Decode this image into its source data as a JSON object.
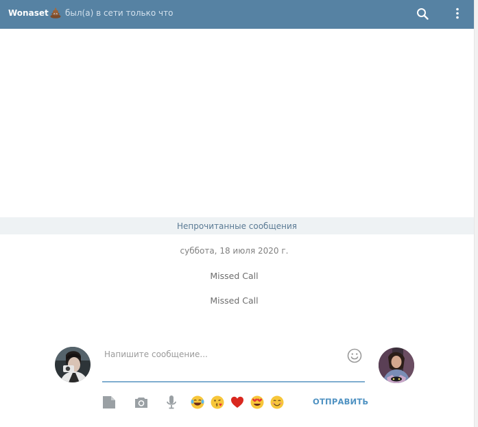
{
  "header": {
    "contact_name": "Wonaset",
    "emoji_icon": "pile-of-poo-icon",
    "status": "был(а) в сети только что",
    "background_color": "#5682a3"
  },
  "messages": {
    "unread_label": "Непрочитанные сообщения",
    "date": "суббота, 18 июля 2020 г.",
    "items": [
      "Missed Call",
      "Missed Call"
    ]
  },
  "composer": {
    "placeholder": "Напишите сообщение...",
    "value": "",
    "send_label": "ОТПРАВИТЬ",
    "tools": [
      "document-icon",
      "camera-icon",
      "microphone-icon"
    ],
    "quick_emojis": [
      "face-with-tears-of-joy-icon",
      "face-blowing-kiss-icon",
      "red-heart-icon",
      "heart-eyes-icon",
      "smiling-face-icon"
    ]
  },
  "colors": {
    "accent": "#4f92c2",
    "underline": "#7eaccf",
    "unread_band": "#eef2f4"
  }
}
